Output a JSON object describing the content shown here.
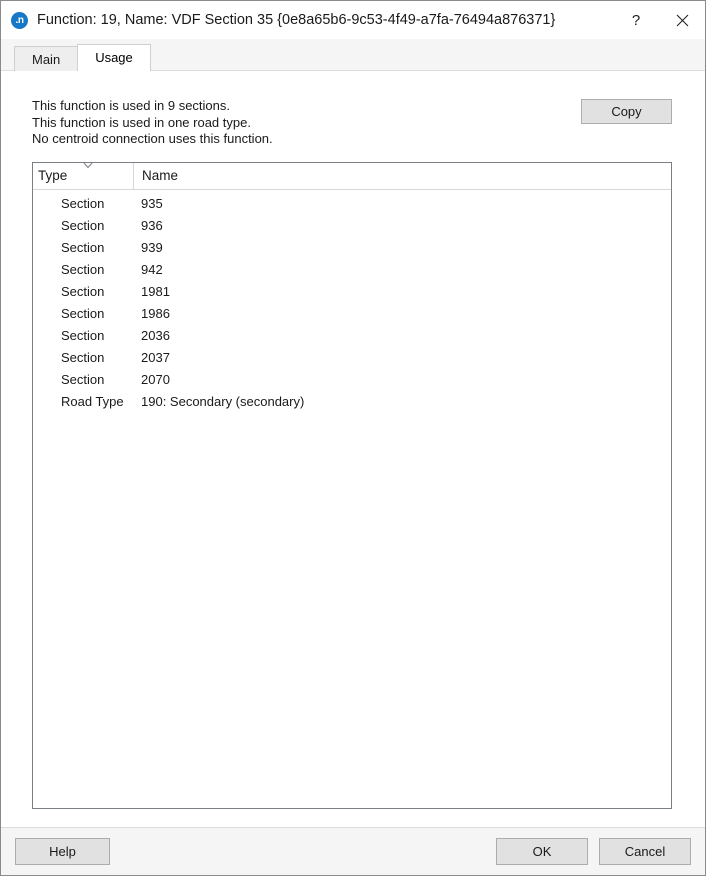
{
  "window": {
    "icon_label": ".n",
    "title": "Function: 19, Name: VDF Section 35  {0e8a65b6-9c53-4f49-a7fa-76494a876371}",
    "help_button_label": "?",
    "close_button_label": "✕"
  },
  "tabs": [
    {
      "label": "Main",
      "active": false
    },
    {
      "label": "Usage",
      "active": true
    }
  ],
  "usage": {
    "info_lines": [
      "This function is used in 9 sections.",
      "This function is used in one road type.",
      "No centroid connection uses this function."
    ],
    "copy_label": "Copy",
    "table": {
      "columns": [
        "Type",
        "Name"
      ],
      "sort_column": "Type",
      "sort_direction": "descending",
      "rows": [
        {
          "type": "Section",
          "name": "935"
        },
        {
          "type": "Section",
          "name": "936"
        },
        {
          "type": "Section",
          "name": "939"
        },
        {
          "type": "Section",
          "name": "942"
        },
        {
          "type": "Section",
          "name": "1981"
        },
        {
          "type": "Section",
          "name": "1986"
        },
        {
          "type": "Section",
          "name": "2036"
        },
        {
          "type": "Section",
          "name": "2037"
        },
        {
          "type": "Section",
          "name": "2070"
        },
        {
          "type": "Road Type",
          "name": "190: Secondary (secondary)"
        }
      ]
    }
  },
  "footer": {
    "help_label": "Help",
    "ok_label": "OK",
    "cancel_label": "Cancel"
  },
  "colors": {
    "accent": "#1878c8",
    "dialog_bg": "#ffffff",
    "footer_bg": "#f5f5f5",
    "button_bg": "#e1e1e1",
    "border": "#7a7f86"
  }
}
